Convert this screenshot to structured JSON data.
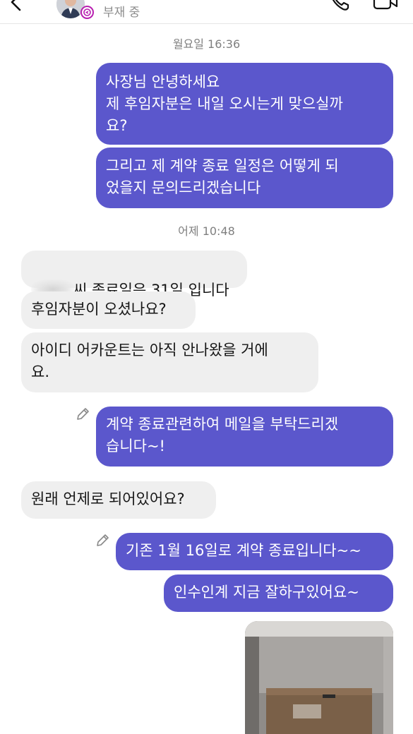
{
  "header": {
    "status": "부재 중",
    "icons": {
      "back": "chevron-left-icon",
      "call": "phone-icon",
      "video": "video-camera-icon"
    }
  },
  "conversation": {
    "timestamps": [
      "월요일 16:36",
      "어제 10:48"
    ],
    "messages": [
      {
        "direction": "out",
        "text": "사장님 안녕하세요\n제 후임자분은 내일 오시는게 맞으실까\n요?"
      },
      {
        "direction": "out",
        "text": "그리고 제 계약 종료 일정은 어떻게 되\n었을지 문의드리겠습니다"
      },
      {
        "direction": "in",
        "text": "씨 종료일은 31일 입니다"
      },
      {
        "direction": "in",
        "text": "후임자분이 오셨나요?"
      },
      {
        "direction": "in",
        "text": "아이디 어카운트는 아직 안나왔을 거에\n요."
      },
      {
        "direction": "out",
        "text": "계약 종료관련하여 메일을 부탁드리겠\n습니다~!",
        "edited": true
      },
      {
        "direction": "in",
        "text": "원래 언제로 되어있어요?"
      },
      {
        "direction": "out",
        "text": "기존 1월 16일로 계약 종료입니다~~",
        "edited": true
      },
      {
        "direction": "out",
        "text": "인수인계 지금 잘하구있어요~"
      },
      {
        "direction": "out",
        "type": "photo"
      }
    ]
  },
  "colors": {
    "outgoing_bubble": "#5b57cc",
    "incoming_bubble": "#efefef",
    "timestamp": "#7f7f7f",
    "status_ring": "#b81fb0"
  }
}
